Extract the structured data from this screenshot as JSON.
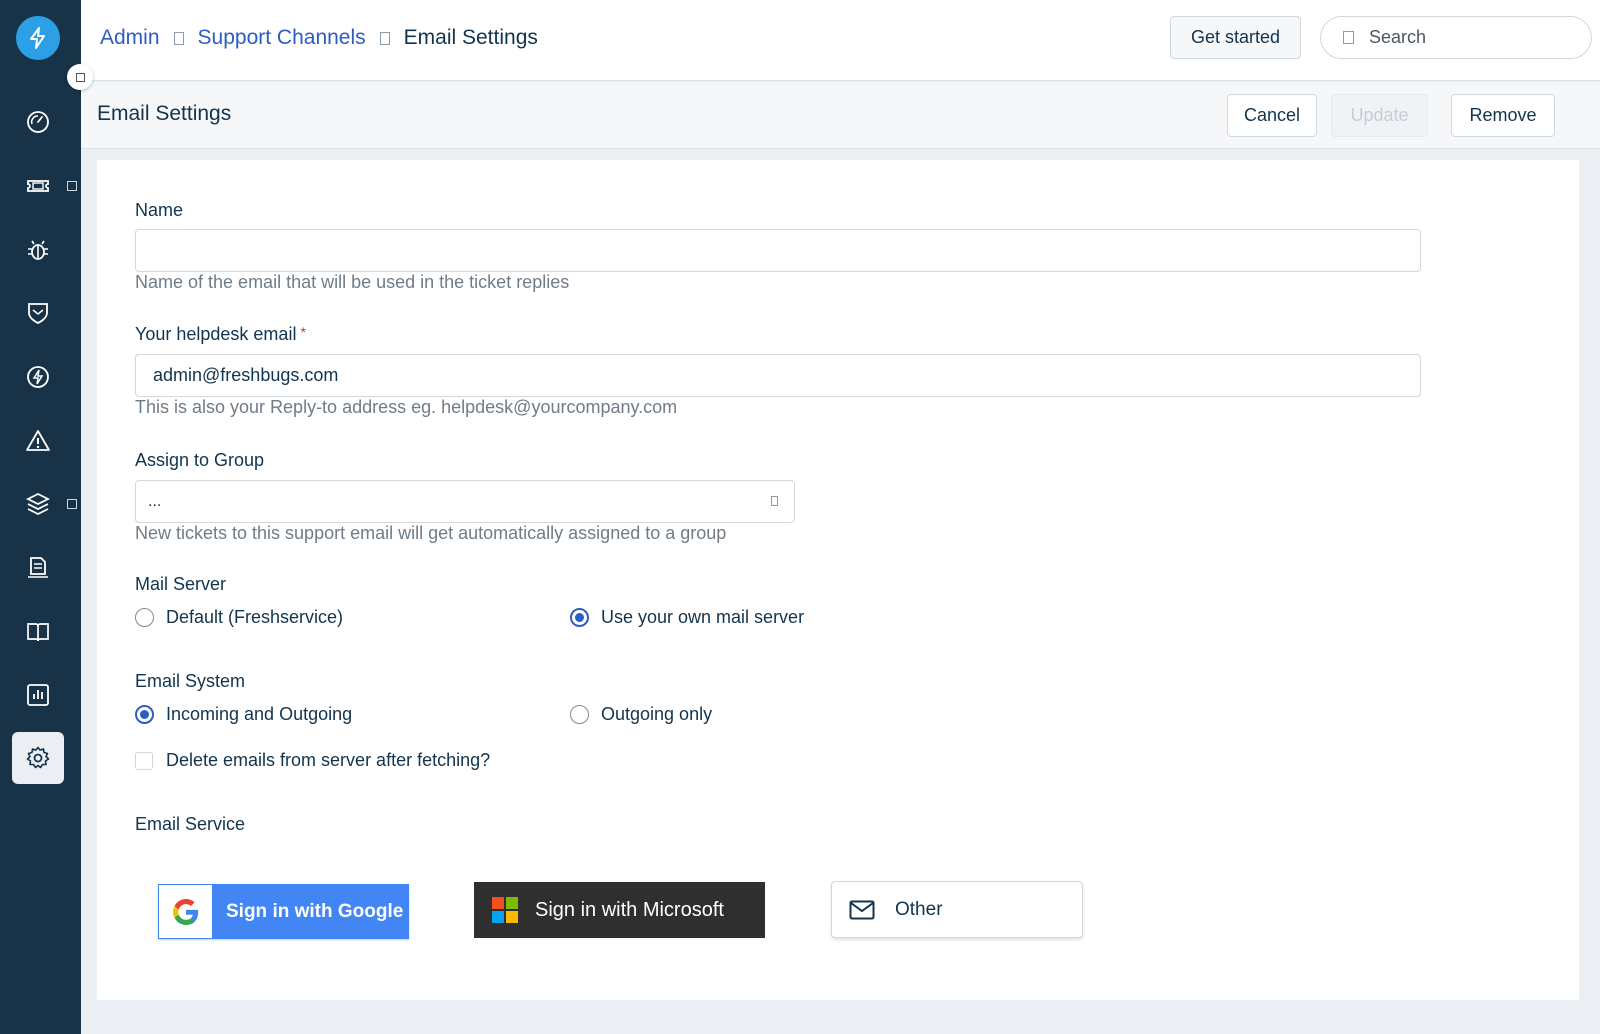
{
  "sidebar": {
    "items": [
      {
        "name": "dashboard",
        "icon": "gauge-icon"
      },
      {
        "name": "tickets",
        "icon": "ticket-icon",
        "has_submenu": true
      },
      {
        "name": "problems",
        "icon": "bug-icon"
      },
      {
        "name": "changes",
        "icon": "shield-icon"
      },
      {
        "name": "releases",
        "icon": "bolt-icon"
      },
      {
        "name": "alerts",
        "icon": "alert-triangle-icon"
      },
      {
        "name": "assets",
        "icon": "layers-icon",
        "has_submenu": true
      },
      {
        "name": "contracts",
        "icon": "document-icon"
      },
      {
        "name": "solutions",
        "icon": "book-icon"
      },
      {
        "name": "analytics",
        "icon": "bar-chart-icon"
      },
      {
        "name": "admin",
        "icon": "gear-icon",
        "active": true
      }
    ]
  },
  "header": {
    "breadcrumb": [
      "Admin",
      "Support Channels",
      "Email Settings"
    ],
    "get_started": "Get started",
    "search_placeholder": "Search"
  },
  "subheader": {
    "title": "Email Settings",
    "cancel": "Cancel",
    "update": "Update",
    "remove": "Remove"
  },
  "form": {
    "name_label": "Name",
    "name_value": "",
    "name_hint": "Name of the email that will be used in the ticket replies",
    "email_label": "Your helpdesk email",
    "email_required_mark": "*",
    "email_value": "admin@freshbugs.com",
    "email_hint": "This is also your Reply-to address eg. helpdesk@yourcompany.com",
    "group_label": "Assign to Group",
    "group_value": "...",
    "group_hint": "New tickets to this support email will get automatically assigned to a group",
    "mail_server_label": "Mail Server",
    "mail_server_options": [
      {
        "label": "Default (Freshservice)",
        "checked": false
      },
      {
        "label": "Use your own mail server",
        "checked": true
      }
    ],
    "email_system_label": "Email System",
    "email_system_options": [
      {
        "label": "Incoming and Outgoing",
        "checked": true
      },
      {
        "label": "Outgoing only",
        "checked": false
      }
    ],
    "delete_emails_label": "Delete emails from server after fetching?",
    "delete_emails_checked": false,
    "email_service_label": "Email Service",
    "services": {
      "google": "Sign in with Google",
      "microsoft": "Sign in with Microsoft",
      "other": "Other"
    }
  },
  "colors": {
    "sidebar_bg": "#183247",
    "link": "#2c5cc5",
    "google_blue": "#4285f4",
    "microsoft_dark": "#2f2f2f"
  }
}
